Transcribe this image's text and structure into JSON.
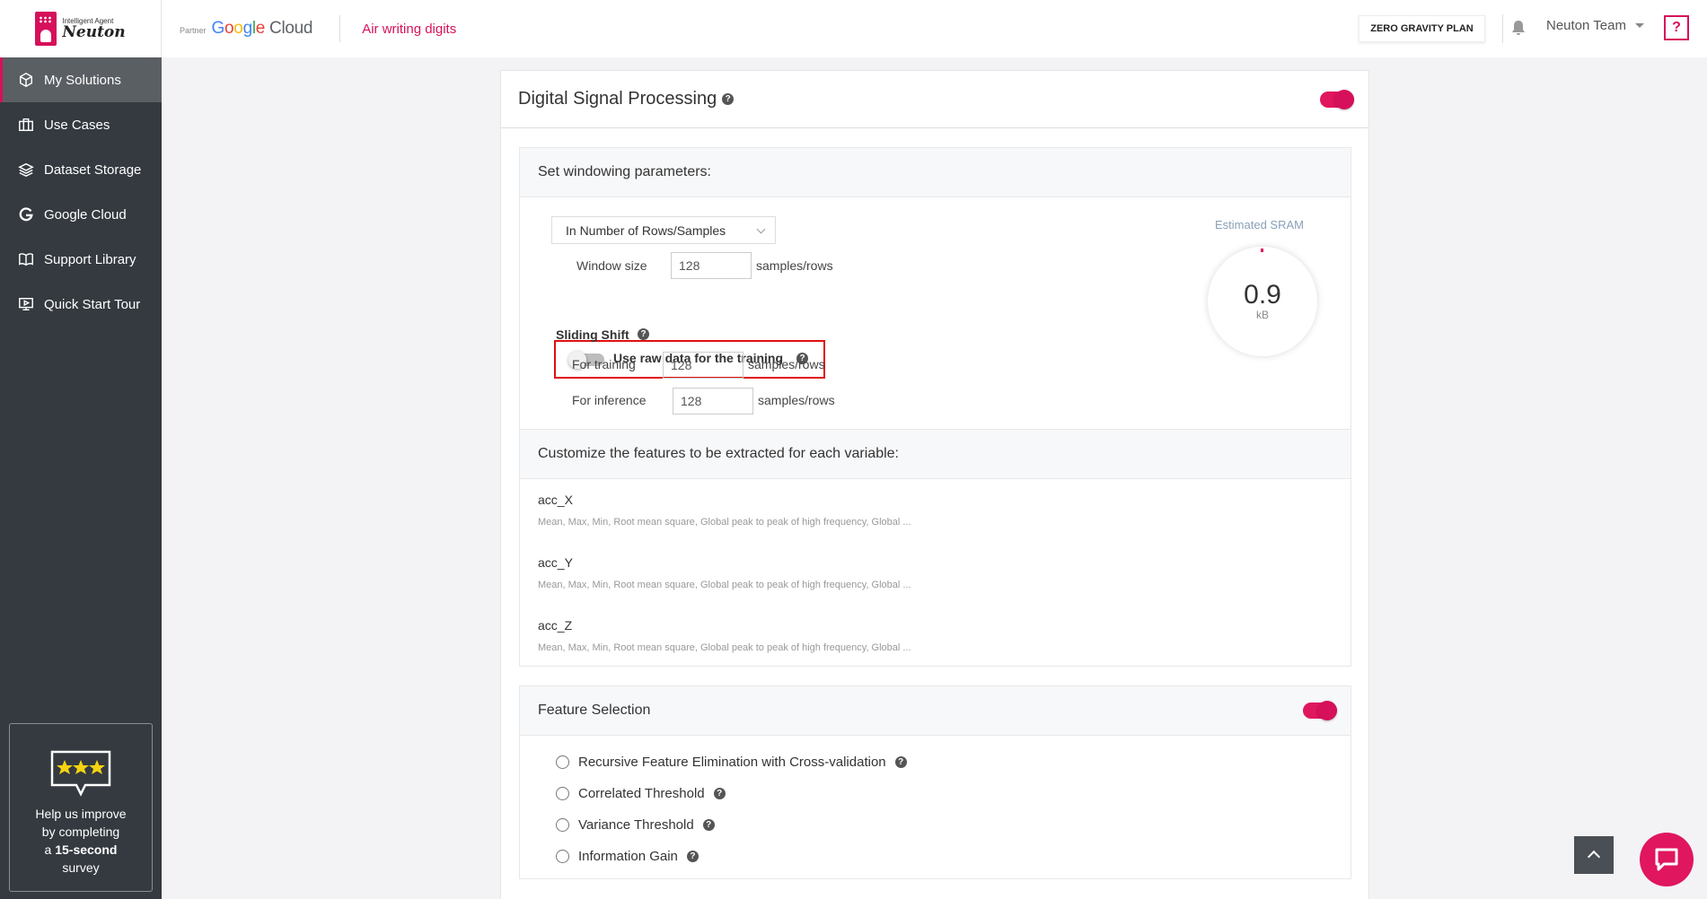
{
  "logo": {
    "small": "Intelligent Agent",
    "big": "Neuton"
  },
  "sidebar": {
    "items": [
      {
        "label": "My Solutions",
        "icon": "cube-icon"
      },
      {
        "label": "Use Cases",
        "icon": "briefcase-icon"
      },
      {
        "label": "Dataset Storage",
        "icon": "layers-icon"
      },
      {
        "label": "Google Cloud",
        "icon": "google-icon"
      },
      {
        "label": "Support Library",
        "icon": "book-icon"
      },
      {
        "label": "Quick Start Tour",
        "icon": "play-screen-icon"
      }
    ],
    "survey": {
      "line1": "Help us improve",
      "line2": "by completing",
      "line3a": "a ",
      "line3b": "15-second",
      "line4": "survey"
    }
  },
  "topbar": {
    "partner": "Partner",
    "google": "Google",
    "cloud": "Cloud",
    "project": "Air writing digits",
    "plan": "ZERO GRAVITY PLAN",
    "team": "Neuton Team",
    "help": "?"
  },
  "card": {
    "title": "Digital Signal Processing",
    "title_toggle": "on",
    "windowing": {
      "heading": "Set windowing parameters:",
      "mode": "In Number of Rows/Samples",
      "window_size_label": "Window size",
      "window_size": "128",
      "unit": "samples/rows",
      "raw_data_label": "Use raw data for the training",
      "raw_data_toggle": "off",
      "sliding_shift_label": "Sliding Shift",
      "training_label": "For training",
      "training_value": "128",
      "inference_label": "For inference",
      "inference_value": "128",
      "sram_label": "Estimated SRAM",
      "sram_value": "0.9",
      "sram_unit": "kB"
    },
    "features": {
      "heading": "Customize the features to be extracted for each variable:",
      "variables": [
        {
          "name": "acc_X",
          "desc": "Mean, Max, Min, Root mean square, Global peak to peak of high frequency, Global ..."
        },
        {
          "name": "acc_Y",
          "desc": "Mean, Max, Min, Root mean square, Global peak to peak of high frequency, Global ..."
        },
        {
          "name": "acc_Z",
          "desc": "Mean, Max, Min, Root mean square, Global peak to peak of high frequency, Global ..."
        }
      ]
    },
    "selection": {
      "heading": "Feature Selection",
      "toggle": "on",
      "options": [
        "Recursive Feature Elimination with Cross-validation",
        "Correlated Threshold",
        "Variance Threshold",
        "Information Gain"
      ]
    }
  },
  "colors": {
    "accent": "#d6105b",
    "sidebar": "#343a40"
  }
}
